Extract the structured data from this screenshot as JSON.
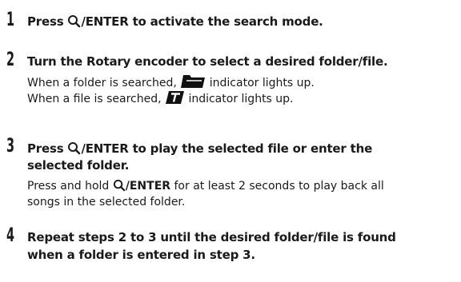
{
  "steps": [
    {
      "number": "1",
      "title_pre": "Press ",
      "title_key": "/ENTER",
      "title_post": " to activate the search mode."
    },
    {
      "number": "2",
      "title_pre": "Turn the ",
      "title_bold_term": "Rotary encoder",
      "title_post": " to select a desired folder/file.",
      "desc_line1_pre": "When a folder is searched, ",
      "desc_line1_post": " indicator lights up.",
      "desc_line2_pre": "When a file is searched, ",
      "desc_line2_post": " indicator lights up."
    },
    {
      "number": "3",
      "title_pre": "Press ",
      "title_key": "/ENTER",
      "title_line1_post": " to play the selected file or enter the",
      "title_line2": "selected folder.",
      "desc_line1_pre": "Press and hold ",
      "desc_key": "/ENTER",
      "desc_line1_post": " for at least 2 seconds to play back all",
      "desc_line2": "songs in the selected folder."
    },
    {
      "number": "4",
      "title_line1": "Repeat steps 2 to 3 until the desired folder/file is found",
      "title_line2": "when a folder is entered in step 3."
    }
  ],
  "icons": {
    "search": "search-icon",
    "folder": "folder-icon",
    "file": "file-icon"
  }
}
